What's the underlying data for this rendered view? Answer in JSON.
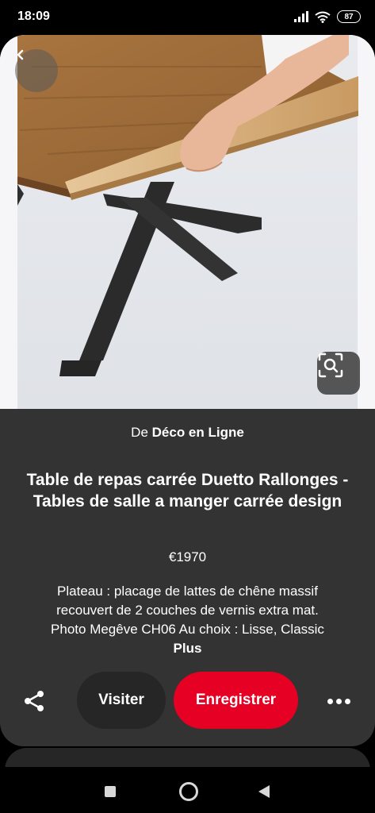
{
  "status_bar": {
    "time": "18:09",
    "battery_level": "87",
    "icons": [
      "signal-icon",
      "wifi-icon",
      "battery-icon"
    ]
  },
  "pin": {
    "image": {
      "subject": "photo",
      "overlay_icons": [
        "back-chevron-icon",
        "visual-search-icon"
      ]
    },
    "source": {
      "prefix": "De",
      "name": "Déco en Ligne"
    },
    "title": "Table de repas carrée Duetto Rallonges - Tables de salle a manger carrée design",
    "price": "€1970",
    "description_lines": [
      "Plateau : placage de lattes de chêne massif",
      "recouvert de 2 couches de vernis extra mat.",
      "Photo Megêve CH06 Au choix : Lisse, Classic",
      "Plus"
    ]
  },
  "actions": {
    "share_icon": "share-icon",
    "visit_label": "Visiter",
    "save_label": "Enregistrer",
    "more_icon": "more-dots-icon"
  },
  "colors": {
    "card_background": "#333333",
    "save_button": "#e60023",
    "visit_button": "#262626"
  },
  "nav_bar": {
    "icons": [
      "recent-apps-icon",
      "home-icon",
      "back-icon"
    ]
  }
}
